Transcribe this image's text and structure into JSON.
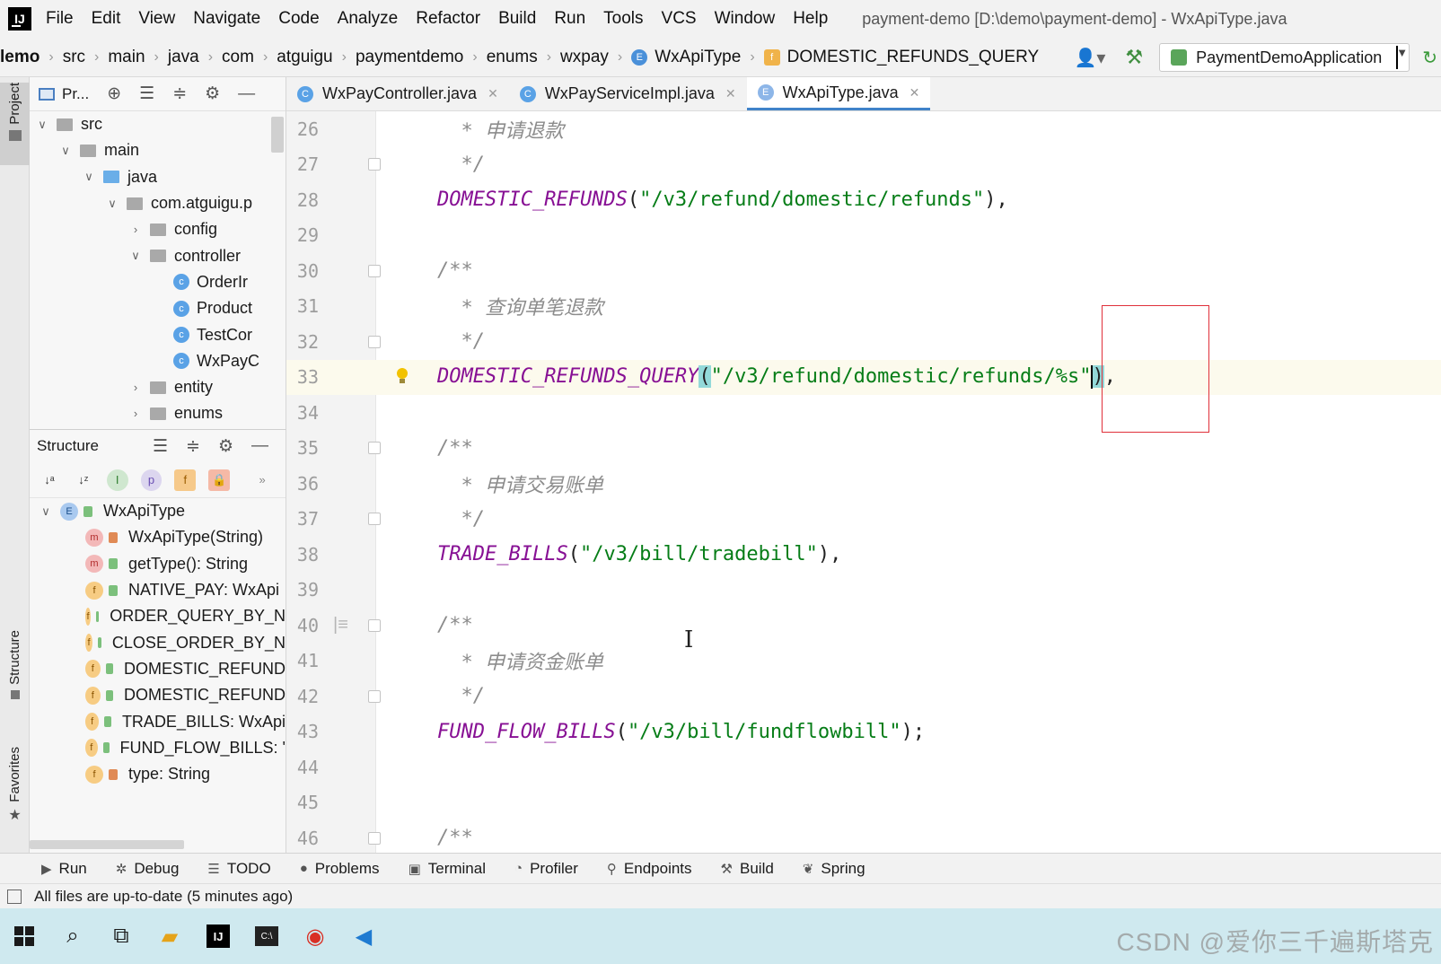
{
  "app": {
    "logo_text": "IJ",
    "window_title": "payment-demo [D:\\demo\\payment-demo] - WxApiType.java"
  },
  "menu": [
    "File",
    "Edit",
    "View",
    "Navigate",
    "Code",
    "Analyze",
    "Refactor",
    "Build",
    "Run",
    "Tools",
    "VCS",
    "Window",
    "Help"
  ],
  "breadcrumb": [
    "lemo",
    "src",
    "main",
    "java",
    "com",
    "atguigu",
    "paymentdemo",
    "enums",
    "wxpay",
    "WxApiType",
    "DOMESTIC_REFUNDS_QUERY"
  ],
  "run_config": "PaymentDemoApplication",
  "left_strip": {
    "project": "Project",
    "structure": "Structure",
    "favorites": "Favorites"
  },
  "project_panel": {
    "title": "Pr...",
    "tree": [
      {
        "label": "src",
        "depth": 1,
        "arrow": "open",
        "icon": "folder"
      },
      {
        "label": "main",
        "depth": 2,
        "arrow": "open",
        "icon": "folder"
      },
      {
        "label": "java",
        "depth": 3,
        "arrow": "open",
        "icon": "folder-blue"
      },
      {
        "label": "com.atguigu.p",
        "depth": 4,
        "arrow": "open",
        "icon": "folder"
      },
      {
        "label": "config",
        "depth": 5,
        "arrow": "closed",
        "icon": "folder"
      },
      {
        "label": "controller",
        "depth": 5,
        "arrow": "open",
        "icon": "folder"
      },
      {
        "label": "OrderIr",
        "depth": 6,
        "arrow": "none",
        "icon": "class"
      },
      {
        "label": "Product",
        "depth": 6,
        "arrow": "none",
        "icon": "class"
      },
      {
        "label": "TestCor",
        "depth": 6,
        "arrow": "none",
        "icon": "class"
      },
      {
        "label": "WxPayC",
        "depth": 6,
        "arrow": "none",
        "icon": "class"
      },
      {
        "label": "entity",
        "depth": 5,
        "arrow": "closed",
        "icon": "folder"
      },
      {
        "label": "enums",
        "depth": 5,
        "arrow": "closed",
        "icon": "folder"
      }
    ]
  },
  "structure_panel": {
    "title": "Structure",
    "tool_buttons": [
      "I",
      "p",
      "f"
    ],
    "root": "WxApiType",
    "members": [
      {
        "kind": "m",
        "vis": "priv",
        "label": "WxApiType(String)"
      },
      {
        "kind": "m",
        "vis": "pub",
        "label": "getType(): String"
      },
      {
        "kind": "f",
        "vis": "pub",
        "label": "NATIVE_PAY: WxApi"
      },
      {
        "kind": "f",
        "vis": "pub",
        "label": "ORDER_QUERY_BY_N"
      },
      {
        "kind": "f",
        "vis": "pub",
        "label": "CLOSE_ORDER_BY_N"
      },
      {
        "kind": "f",
        "vis": "pub",
        "label": "DOMESTIC_REFUND"
      },
      {
        "kind": "f",
        "vis": "pub",
        "label": "DOMESTIC_REFUND"
      },
      {
        "kind": "f",
        "vis": "pub",
        "label": "TRADE_BILLS: WxApi"
      },
      {
        "kind": "f",
        "vis": "pub",
        "label": "FUND_FLOW_BILLS: '"
      },
      {
        "kind": "f",
        "vis": "priv",
        "label": "type: String"
      }
    ]
  },
  "editor_tabs": [
    {
      "label": "WxPayController.java",
      "icon": "C",
      "active": false
    },
    {
      "label": "WxPayServiceImpl.java",
      "icon": "C",
      "active": false
    },
    {
      "label": "WxApiType.java",
      "icon": "E",
      "active": true
    }
  ],
  "code_lines": [
    {
      "n": "26",
      "parts": [
        {
          "t": "  * 申请退款",
          "c": "cm"
        }
      ]
    },
    {
      "n": "27",
      "parts": [
        {
          "t": "  */",
          "c": "cm"
        }
      ],
      "fold": true
    },
    {
      "n": "28",
      "parts": [
        {
          "t": "DOMESTIC_REFUNDS",
          "c": "cn"
        },
        {
          "t": "(",
          "c": ""
        },
        {
          "t": "\"/v3/refund/domestic/refunds\"",
          "c": "str"
        },
        {
          "t": "),",
          "c": ""
        }
      ]
    },
    {
      "n": "29",
      "parts": []
    },
    {
      "n": "30",
      "parts": [
        {
          "t": "/**",
          "c": "cm"
        }
      ],
      "fold": true
    },
    {
      "n": "31",
      "parts": [
        {
          "t": "  * 查询单笔退款",
          "c": "cm"
        }
      ]
    },
    {
      "n": "32",
      "parts": [
        {
          "t": "  */",
          "c": "cm"
        }
      ],
      "fold": true
    },
    {
      "n": "33",
      "parts": [
        {
          "t": "DOMESTIC_REFUNDS_QUERY",
          "c": "cn"
        },
        {
          "t": "(",
          "c": "paren-hl"
        },
        {
          "t": "\"/v3/refund/domestic/refunds/%s\"",
          "c": "str"
        },
        {
          "t": "CARET",
          "c": "caret"
        },
        {
          "t": ")",
          "c": "paren-hl"
        },
        {
          "t": ",",
          "c": ""
        }
      ],
      "current": true,
      "bulb": true
    },
    {
      "n": "34",
      "parts": []
    },
    {
      "n": "35",
      "parts": [
        {
          "t": "/**",
          "c": "cm"
        }
      ],
      "fold": true
    },
    {
      "n": "36",
      "parts": [
        {
          "t": "  * 申请交易账单",
          "c": "cm"
        }
      ]
    },
    {
      "n": "37",
      "parts": [
        {
          "t": "  */",
          "c": "cm"
        }
      ],
      "fold": true
    },
    {
      "n": "38",
      "parts": [
        {
          "t": "TRADE_BILLS",
          "c": "cn"
        },
        {
          "t": "(",
          "c": ""
        },
        {
          "t": "\"/v3/bill/tradebill\"",
          "c": "str"
        },
        {
          "t": "),",
          "c": ""
        }
      ]
    },
    {
      "n": "39",
      "parts": []
    },
    {
      "n": "40",
      "parts": [
        {
          "t": "/**",
          "c": "cm"
        }
      ],
      "fold": true,
      "todo": true
    },
    {
      "n": "41",
      "parts": [
        {
          "t": "  * 申请资金账单",
          "c": "cm"
        }
      ]
    },
    {
      "n": "42",
      "parts": [
        {
          "t": "  */",
          "c": "cm"
        }
      ],
      "fold": true
    },
    {
      "n": "43",
      "parts": [
        {
          "t": "FUND_FLOW_BILLS",
          "c": "cn"
        },
        {
          "t": "(",
          "c": ""
        },
        {
          "t": "\"/v3/bill/fundflowbill\"",
          "c": "str"
        },
        {
          "t": ");",
          "c": ""
        }
      ]
    },
    {
      "n": "44",
      "parts": []
    },
    {
      "n": "45",
      "parts": []
    },
    {
      "n": "46",
      "parts": [
        {
          "t": "/**",
          "c": "cm"
        }
      ],
      "fold": true
    }
  ],
  "tool_windows": [
    {
      "label": "Run",
      "icon": "▶"
    },
    {
      "label": "Debug",
      "icon": "✲"
    },
    {
      "label": "TODO",
      "icon": "☰"
    },
    {
      "label": "Problems",
      "icon": "●"
    },
    {
      "label": "Terminal",
      "icon": "▣"
    },
    {
      "label": "Profiler",
      "icon": "◔"
    },
    {
      "label": "Endpoints",
      "icon": "⚲"
    },
    {
      "label": "Build",
      "icon": "⚒"
    },
    {
      "label": "Spring",
      "icon": "❦"
    }
  ],
  "status": "All files are up-to-date (5 minutes ago)",
  "watermark": "CSDN @爱你三千遍斯塔克"
}
